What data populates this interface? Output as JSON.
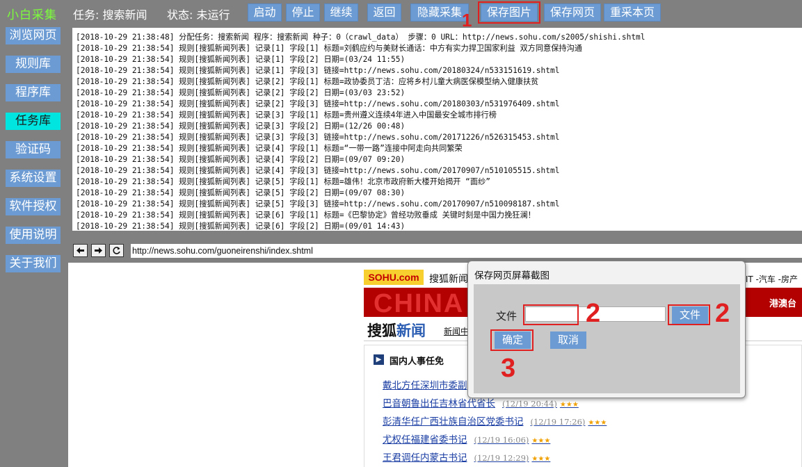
{
  "app": {
    "title": "小白采集"
  },
  "status": {
    "task": "任务: 搜索新闻",
    "state": "状态: 未运行"
  },
  "toolbar": {
    "start": "启动",
    "stop": "停止",
    "resume": "继续",
    "back": "返回",
    "hide": "隐藏采集",
    "save_image": "保存图片",
    "save_page": "保存网页",
    "recapture": "重采本页"
  },
  "sidebar": {
    "items": [
      {
        "label": "浏览网页",
        "active": false
      },
      {
        "label": "规则库",
        "active": false
      },
      {
        "label": "程序库",
        "active": false
      },
      {
        "label": "任务库",
        "active": true
      },
      {
        "label": "验证码",
        "active": false
      },
      {
        "label": "系统设置",
        "active": false
      },
      {
        "label": "软件授权",
        "active": false
      },
      {
        "label": "使用说明",
        "active": false
      },
      {
        "label": "关于我们",
        "active": false
      }
    ]
  },
  "log": {
    "lines": [
      "[2018-10-29 21:38:48] 分配任务：搜索新闻 程序：搜索新闻 种子：0（crawl_data） 步骤：0 URL：http://news.sohu.com/s2005/shishi.shtml",
      "[2018-10-29 21:38:54] 规则[搜狐新闻列表] 记录[1] 字段[1] 标题=刘鹤应约与美财长通话：中方有实力捍卫国家利益 双方同意保持沟通",
      "[2018-10-29 21:38:54] 规则[搜狐新闻列表] 记录[1] 字段[2] 日期=(03/24 11:55)",
      "[2018-10-29 21:38:54] 规则[搜狐新闻列表] 记录[1] 字段[3] 链接=http://news.sohu.com/20180324/n533151619.shtml",
      "[2018-10-29 21:38:54] 规则[搜狐新闻列表] 记录[2] 字段[1] 标题=政协委员丁洁：应将乡村儿童大病医保模型纳入健康扶贫",
      "[2018-10-29 21:38:54] 规则[搜狐新闻列表] 记录[2] 字段[2] 日期=(03/03 23:52)",
      "[2018-10-29 21:38:54] 规则[搜狐新闻列表] 记录[2] 字段[3] 链接=http://news.sohu.com/20180303/n531976409.shtml",
      "[2018-10-29 21:38:54] 规则[搜狐新闻列表] 记录[3] 字段[1] 标题=贵州遵义连续4年进入中国最安全城市排行榜",
      "[2018-10-29 21:38:54] 规则[搜狐新闻列表] 记录[3] 字段[2] 日期=(12/26 00:48)",
      "[2018-10-29 21:38:54] 规则[搜狐新闻列表] 记录[3] 字段[3] 链接=http://news.sohu.com/20171226/n526315453.shtml",
      "[2018-10-29 21:38:54] 规则[搜狐新闻列表] 记录[4] 字段[1] 标题=“一带一路”连接中阿走向共同繁荣",
      "[2018-10-29 21:38:54] 规则[搜狐新闻列表] 记录[4] 字段[2] 日期=(09/07 09:20)",
      "[2018-10-29 21:38:54] 规则[搜狐新闻列表] 记录[4] 字段[3] 链接=http://news.sohu.com/20170907/n510105515.shtml",
      "[2018-10-29 21:38:54] 规则[搜狐新闻列表] 记录[5] 字段[1] 标题=雄伟！北京市政府新大楼开始揭开 “面纱”",
      "[2018-10-29 21:38:54] 规则[搜狐新闻列表] 记录[5] 字段[2] 日期=(09/07 08:30)",
      "[2018-10-29 21:38:54] 规则[搜狐新闻列表] 记录[5] 字段[3] 链接=http://news.sohu.com/20170907/n510098187.shtml",
      "[2018-10-29 21:38:54] 规则[搜狐新闻列表] 记录[6] 字段[1] 标题=《巴黎协定》曾经功败垂成 关键时刻是中国力挽狂澜！",
      "[2018-10-29 21:38:54] 规则[搜狐新闻列表] 记录[6] 字段[2] 日期=(09/01 14:43)"
    ]
  },
  "nav": {
    "back_icon": "arrow-left",
    "forward_icon": "arrow-right",
    "refresh_icon": "refresh",
    "url": "http://news.sohu.com/guoneirenshi/index.shtml"
  },
  "webpage": {
    "logo": "SOHU.com",
    "news_link": "搜狐新闻",
    "header_right": "-IT -汽车 -房产",
    "banner": "CHINA",
    "gang_tai": "港澳台",
    "title_a": "搜狐",
    "title_b": "新闻",
    "sub": "新闻中",
    "section": "国内人事任免",
    "items": [
      {
        "title": "戴北方任深圳市委副",
        "date": "",
        "stars": ""
      },
      {
        "title": "巴音朝鲁出任吉林省代省长",
        "date": "(12/19 20:44)",
        "stars": "★★★"
      },
      {
        "title": "彭清华任广西壮族自治区党委书记",
        "date": "(12/19 17:26)",
        "stars": "★★★"
      },
      {
        "title": "尤权任福建省委书记",
        "date": "(12/19 16:06)",
        "stars": "★★★"
      },
      {
        "title": "王君调任内蒙古书记",
        "date": "(12/19 12:29)",
        "stars": "★★★"
      }
    ]
  },
  "dialog": {
    "title": "保存网页屏幕截图",
    "file_label": "文件",
    "file_value": "",
    "browse": "文件",
    "ok": "确定",
    "cancel": "取消"
  },
  "annotations": {
    "n1": "1",
    "n2a": "2",
    "n2b": "2",
    "n3": "3",
    "color": "#e02020"
  }
}
